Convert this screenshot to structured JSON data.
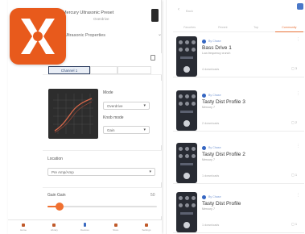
{
  "brand": {
    "accent": "#e85a1c",
    "selected_tab_color": "#e8733a",
    "icon_name": "x-star-logo-icon"
  },
  "left_screen": {
    "title": "Mercury Ultrasonic Preset",
    "subtitle": "Overdrive",
    "section": "Ultrasonic Properties",
    "segments": [
      "Channel 1",
      "",
      ""
    ],
    "graph_label": "Mode",
    "mode_select": "Overdrive",
    "knob_mode_label": "Knob mode",
    "knob_mode_select": "Gain",
    "location_label": "Location",
    "location_select": "Pre Amp/Amp",
    "slider_label": "Gain Gain",
    "slider_value": "50",
    "slider_fraction": 0.11,
    "tabbar": [
      "Home",
      "Library",
      "Devices",
      "Store",
      "Settings"
    ]
  },
  "right_screen": {
    "back_label": "Back",
    "tabs": [
      "Favorites",
      "Recent",
      "Top",
      "Community"
    ],
    "active_tab": 3,
    "presets": [
      {
        "author": "By Chase",
        "title": "Bass Drive 1",
        "desc": "Low-frequency crunch",
        "footer": "4 downloads",
        "comments": "3"
      },
      {
        "author": "By Chase",
        "title": "Tasty Dist Profile 3",
        "desc": "Mercury 7",
        "footer": "2 downloads",
        "comments": "2"
      },
      {
        "author": "By Chase",
        "title": "Tasty Dist Profile 2",
        "desc": "Mercury 7",
        "footer": "1 downloads",
        "comments": "1"
      },
      {
        "author": "By Chase",
        "title": "Tasty Dist Profile",
        "desc": "Mercury 7",
        "footer": "1 downloads",
        "comments": "1"
      }
    ]
  }
}
